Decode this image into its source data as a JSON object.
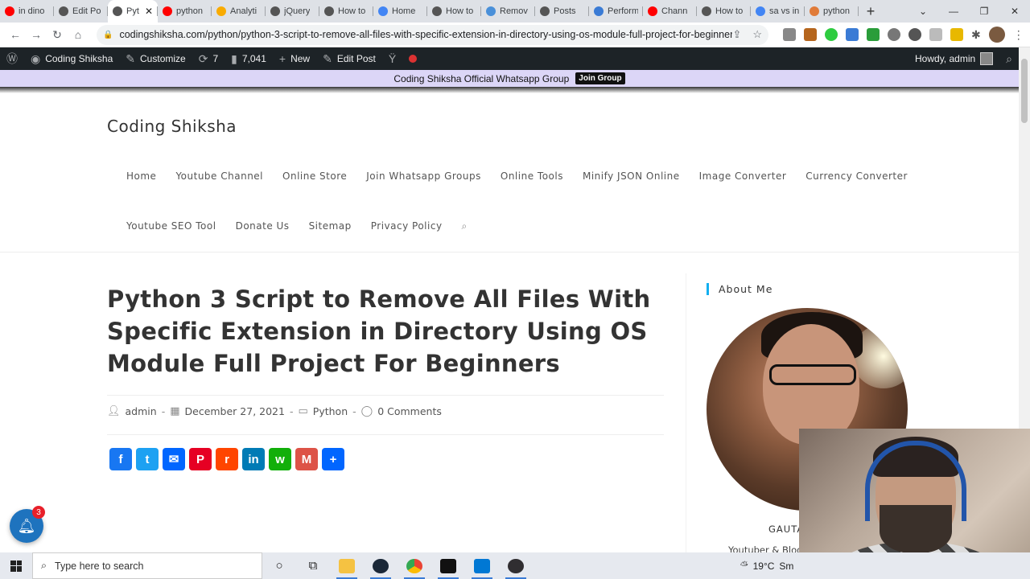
{
  "browser": {
    "tabs": [
      {
        "label": "in dino",
        "fav": "#ff0000"
      },
      {
        "label": "Edit Po",
        "fav": "#555555"
      },
      {
        "label": "Pyt",
        "fav": "#555555",
        "active": true
      },
      {
        "label": "python",
        "fav": "#ff0000"
      },
      {
        "label": "Analyti",
        "fav": "#f9ab00"
      },
      {
        "label": "jQuery",
        "fav": "#555555"
      },
      {
        "label": "How to",
        "fav": "#555555"
      },
      {
        "label": "Home",
        "fav": "#4285f4"
      },
      {
        "label": "How to",
        "fav": "#555555"
      },
      {
        "label": "Remov",
        "fav": "#4a90d9"
      },
      {
        "label": "Posts",
        "fav": "#555555"
      },
      {
        "label": "Perform",
        "fav": "#3a7bd5"
      },
      {
        "label": "Chann",
        "fav": "#ff0000"
      },
      {
        "label": "How to",
        "fav": "#555555"
      },
      {
        "label": "sa vs in",
        "fav": "#4285f4"
      },
      {
        "label": "python",
        "fav": "#e07b39"
      }
    ],
    "new_tab": "+",
    "url": "codingshiksha.com/python/python-3-script-to-remove-all-files-with-specific-extension-in-directory-using-os-module-full-project-for-beginners/"
  },
  "wp_admin_bar": {
    "site_name": "Coding Shiksha",
    "customize": "Customize",
    "updates_count": "7",
    "comments_count": "7,041",
    "new": "New",
    "edit_post": "Edit Post",
    "howdy": "Howdy, admin"
  },
  "notice": {
    "text": "Coding Shiksha Official Whatsapp Group",
    "button": "Join Group"
  },
  "site": {
    "title": "Coding Shiksha",
    "menu_row1": [
      "Home",
      "Youtube Channel",
      "Online Store",
      "Join Whatsapp Groups",
      "Online Tools",
      "Minify JSON Online",
      "Image Converter",
      "Currency Converter"
    ],
    "menu_row2": [
      "Youtube SEO Tool",
      "Donate Us",
      "Sitemap",
      "Privacy Policy"
    ]
  },
  "post": {
    "title": "Python 3 Script to Remove All Files With Specific Extension in Directory Using OS Module Full Project For Beginners",
    "author": "admin",
    "date": "December 27, 2021",
    "category": "Python",
    "comments": "0 Comments",
    "share_buttons": [
      {
        "name": "facebook",
        "glyph": "f",
        "color": "#1877f2"
      },
      {
        "name": "twitter",
        "glyph": "t",
        "color": "#1da1f2"
      },
      {
        "name": "email",
        "glyph": "✉",
        "color": "#0166ff"
      },
      {
        "name": "pinterest",
        "glyph": "P",
        "color": "#e60023"
      },
      {
        "name": "reddit",
        "glyph": "r",
        "color": "#ff4500"
      },
      {
        "name": "linkedin",
        "glyph": "in",
        "color": "#007bb5"
      },
      {
        "name": "whatsapp",
        "glyph": "w",
        "color": "#12af0a"
      },
      {
        "name": "gmail",
        "glyph": "M",
        "color": "#dd5347"
      },
      {
        "name": "share",
        "glyph": "+",
        "color": "#0166ff"
      }
    ]
  },
  "sidebar": {
    "widget_title": "About Me",
    "name_partial": "GAUTA",
    "subtitle_partial": "Youtuber & Blog"
  },
  "notifications": {
    "count": "3"
  },
  "taskbar": {
    "search_placeholder": "Type here to search",
    "weather": "19°C",
    "weather_partial": "Sm"
  },
  "colors": {
    "wp_bar": "#1d2327",
    "notice_bg": "#dcd6f7",
    "accent": "#13aff0",
    "notif_blue": "#1e73be"
  }
}
